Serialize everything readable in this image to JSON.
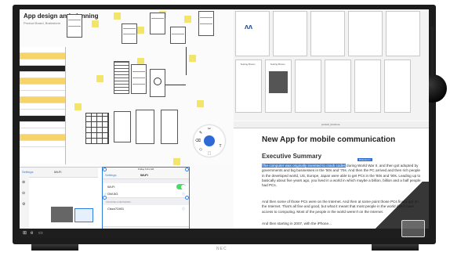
{
  "device": {
    "brand": "NEC"
  },
  "whiteboard": {
    "title": "App design and planning",
    "subtitle": "Product Board, Brainstorm"
  },
  "radial_menu": {
    "tools": [
      "✂",
      "✎",
      "⌫",
      "T",
      "◇",
      "⬚"
    ]
  },
  "tablet": {
    "back_label": "Settings",
    "title": "Wi-Fi"
  },
  "phone": {
    "status": "Friday 9:41 AM",
    "back_label": "Settings",
    "title": "Wi-Fi",
    "rows": {
      "wifi": "Wi-Fi",
      "network": "GW-5G",
      "section": "CHOOSE A NETWORK...",
      "net2": "Cisco72401"
    }
  },
  "document": {
    "tab_label": "product_brochure",
    "heading": "New App for mobile communication",
    "subheading": "Executive Summary",
    "tag": "Brainstorm",
    "p1_highlight": "The computer was originally invented to crack codes",
    "p1_rest": " during World War II, and then got adopted by governments and big businesses in the '50s and '70s. And then the PC arrived and then rich people in the developed world, US, Europe, Japan were able to get PCs in the '80s and '90s. Leading up to basically about five years ago, you lived in a world in which maybe a billion, billion and a half people had PCs.",
    "p2": "And then some of those PCs were on the Internet. And then at some point those PCs finally got on the Internet. That's all fine and good, but what it meant that most people in the world didn't have access to computing. Most of the people in the world weren't on the Internet.",
    "p3": "And then starting in 2007, with the iPhone..."
  },
  "gallery": {
    "captions": [
      "Testing Brown",
      "Testing Brown"
    ]
  }
}
